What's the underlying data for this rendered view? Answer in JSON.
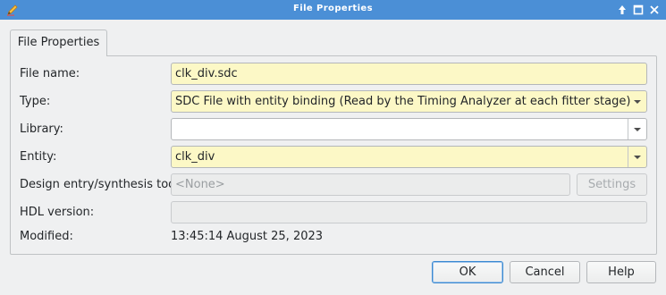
{
  "window": {
    "title": "File Properties",
    "controls": [
      "keep-above-icon",
      "maximize-icon",
      "close-icon"
    ]
  },
  "tab": {
    "label": "File Properties"
  },
  "form": {
    "file_name": {
      "label": "File name:",
      "value": "clk_div.sdc"
    },
    "type": {
      "label": "Type:",
      "value": "SDC File with entity binding (Read by the Timing Analyzer at each fitter stage)"
    },
    "library": {
      "label": "Library:",
      "value": ""
    },
    "entity": {
      "label": "Entity:",
      "value": "clk_div"
    },
    "design_tool": {
      "label": "Design entry/synthesis tool:",
      "value": "<None>",
      "settings_label": "Settings"
    },
    "hdl_version": {
      "label": "HDL version:",
      "value": ""
    },
    "modified": {
      "label": "Modified:",
      "value": "13:45:14 August 25, 2023"
    }
  },
  "buttons": {
    "ok": "OK",
    "cancel": "Cancel",
    "help": "Help"
  },
  "colors": {
    "titlebar": "#4b8fd6",
    "required_field": "#fcf8c6",
    "default_button_border": "#3b8ad1"
  }
}
